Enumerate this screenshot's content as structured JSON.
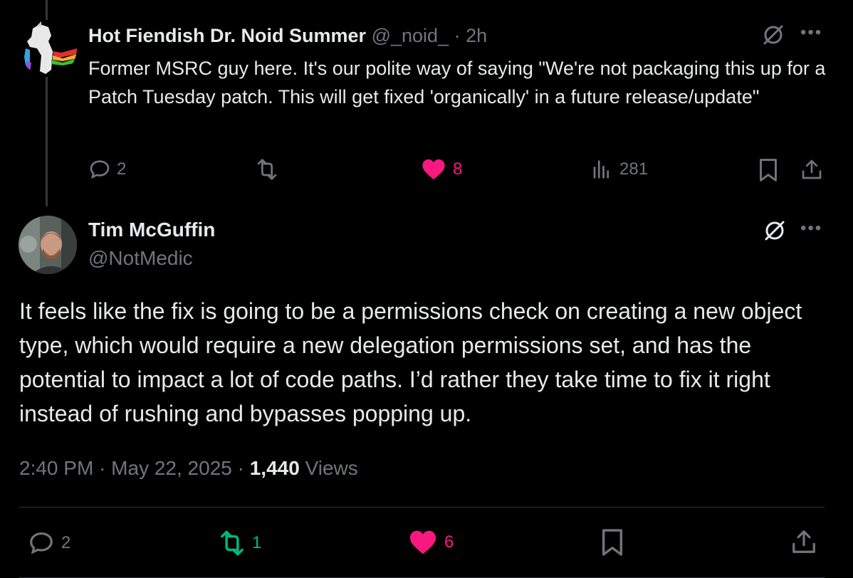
{
  "reply": {
    "author_name": "Hot Fiendish Dr. Noid Summer",
    "author_handle": "@_noid_",
    "separator": "·",
    "time": "2h",
    "text": "Former MSRC guy here. It's our polite way of saying \"We're not packaging this up for a Patch Tuesday patch. This will get fixed 'organically' in a future release/update\"",
    "replies": "2",
    "reposts": "",
    "likes": "8",
    "views": "281"
  },
  "main": {
    "author_name": "Tim McGuffin",
    "author_handle": "@NotMedic",
    "text": "It feels like the fix is going to be a permissions check on creating a new object type, which would require a new delegation permissions set, and has the potential to impact a lot of code paths. I’d rather they take time to fix it right instead of rushing and bypasses popping up.",
    "time": "2:40 PM",
    "separator": "·",
    "date": "May 22, 2025",
    "view_count": "1,440",
    "views_label": "Views",
    "replies": "2",
    "reposts": "1",
    "likes": "6"
  },
  "icons": {
    "more": "more-icon",
    "grok": "grok-icon",
    "reply": "reply-icon",
    "repost": "repost-icon",
    "like": "heart-icon",
    "views": "views-icon",
    "bookmark": "bookmark-icon",
    "share": "share-icon"
  },
  "colors": {
    "background": "#000000",
    "text": "#e7e9ea",
    "muted": "#71767b",
    "like_active": "#f91880",
    "repost_active": "#00ba7c",
    "divider": "#2f3336"
  }
}
